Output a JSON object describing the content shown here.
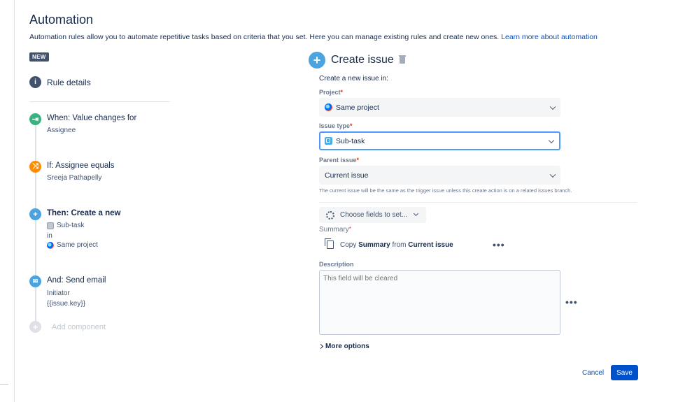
{
  "header": {
    "title": "Automation",
    "description": "Automation rules allow you to automate repetitive tasks based on criteria that you set. Here you can manage existing rules and create new ones.",
    "link": "Learn more about automation"
  },
  "badge": "NEW",
  "rule_details": {
    "icon": "info-icon",
    "label": "Rule details"
  },
  "steps": [
    {
      "icon": "trigger-icon",
      "color": "#36b37e",
      "title": "When: Value changes for",
      "lines": [
        "Assignee"
      ]
    },
    {
      "icon": "shuffle-icon",
      "color": "#ff8b00",
      "title": "If: Assignee equals",
      "lines": [
        "Sreeja Pathapelly"
      ]
    },
    {
      "icon": "plus-icon",
      "color": "#4ba3e0",
      "title": "Then: Create a new",
      "lines": [
        "Sub-task",
        "in",
        "Same project"
      ]
    },
    {
      "icon": "mail-icon",
      "color": "#4ba3e0",
      "title": "And: Send email",
      "lines": [
        "Initiator",
        "{{issue.key}}"
      ]
    }
  ],
  "add_component": "Add component",
  "panel": {
    "title": "Create issue",
    "create_in": "Create a new issue in:",
    "project": {
      "label": "Project",
      "value": "Same project"
    },
    "issue_type": {
      "label": "Issue type",
      "value": "Sub-task"
    },
    "parent_issue": {
      "label": "Parent issue",
      "value": "Current issue",
      "help": "The current issue will be the same as the trigger issue unless this create action is on a related issues branch."
    },
    "choose_fields": "Choose fields to set...",
    "summary": {
      "label": "Summary",
      "copy_prefix": "Copy",
      "copy_field": "Summary",
      "copy_from": "from",
      "copy_source": "Current issue"
    },
    "description": {
      "label": "Description",
      "placeholder": "This field will be cleared"
    },
    "more_options": "More options",
    "cancel": "Cancel",
    "save": "Save",
    "more_dots": "•••"
  },
  "colors": {
    "primary": "#0052cc",
    "focus": "#4c9aff",
    "required": "#de350b"
  }
}
